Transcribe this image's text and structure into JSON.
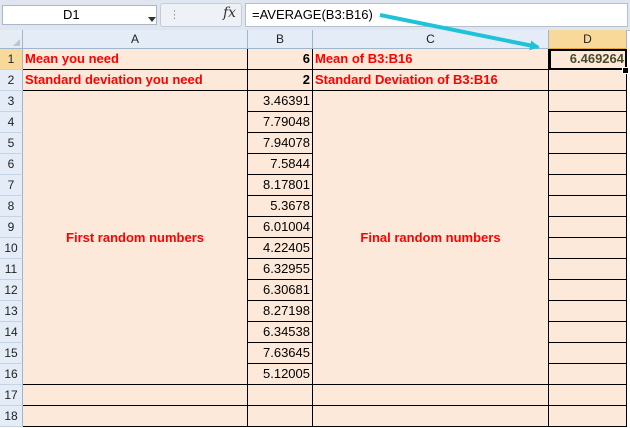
{
  "formula_bar": {
    "name_box": "D1",
    "fx": "fx",
    "formula": "=AVERAGE(B3:B16)"
  },
  "columns": [
    "A",
    "B",
    "C",
    "D"
  ],
  "rows": [
    "1",
    "2",
    "3",
    "4",
    "5",
    "6",
    "7",
    "8",
    "9",
    "10",
    "11",
    "12",
    "13",
    "14",
    "15",
    "16",
    "17",
    "18"
  ],
  "cells": {
    "a1": "Mean you need",
    "b1": "6",
    "c1": "Mean of B3:B16",
    "d1": "6.469264",
    "a2": "Standard deviation you need",
    "b2": "2",
    "c2": "Standard Deviation of B3:B16",
    "merged_a": "First random numbers",
    "merged_c": "Final random numbers",
    "b_values": [
      "3.46391",
      "7.79048",
      "7.94078",
      "7.5844",
      "8.17801",
      "5.3678",
      "6.01004",
      "4.22405",
      "6.32955",
      "6.30681",
      "8.27198",
      "6.34538",
      "7.63645",
      "5.12005"
    ]
  },
  "colors": {
    "cell_fill": "#fde9d9",
    "label_red": "#ff0000",
    "selected_header": "#f9d99a",
    "arrow": "#1fc3d8"
  },
  "icons": {
    "namebox_dropdown": "chevron-down-icon",
    "formula_function": "fx-icon",
    "annotation": "arrow-icon"
  }
}
